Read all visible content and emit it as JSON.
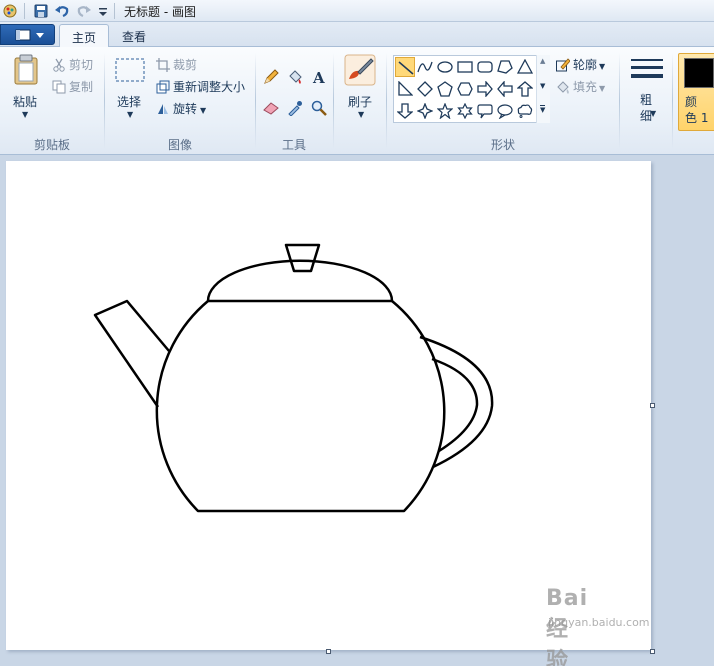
{
  "window": {
    "title": "无标题 - 画图"
  },
  "quick_access": {
    "icons": [
      "paint-app-icon",
      "save-icon",
      "undo-icon",
      "redo-icon",
      "customize-dropdown-icon"
    ]
  },
  "tabs": [
    {
      "label": "主页",
      "active": true
    },
    {
      "label": "查看",
      "active": false
    }
  ],
  "ribbon": {
    "clipboard": {
      "paste": "粘贴",
      "cut": "剪切",
      "copy": "复制",
      "label": "剪贴板"
    },
    "image": {
      "select": "选择",
      "crop": "裁剪",
      "resize": "重新调整大小",
      "rotate": "旋转",
      "label": "图像"
    },
    "tools": {
      "label": "工具",
      "icons": [
        "pencil-icon",
        "fill-bucket-icon",
        "text-icon",
        "eraser-icon",
        "color-picker-icon",
        "magnifier-icon"
      ]
    },
    "brushes": {
      "label": "刷子"
    },
    "shapes": {
      "label": "形状",
      "outline": "轮廓",
      "fill": "填充",
      "items": [
        "line",
        "curve",
        "oval",
        "rectangle",
        "rounded-rectangle",
        "polygon",
        "triangle",
        "right-triangle",
        "diamond",
        "pentagon",
        "hexagon",
        "right-arrow",
        "left-arrow",
        "up-arrow",
        "down-arrow",
        "four-point-star",
        "five-point-star",
        "six-point-star",
        "rounded-callout",
        "oval-callout",
        "cloud-callout"
      ],
      "selected": "line"
    },
    "size": {
      "label": "粗\n细"
    },
    "color1": {
      "label": "颜\n色 1",
      "color": "#000000"
    }
  },
  "canvas": {
    "background": "#ffffff",
    "drawing": "teapot-line-drawing"
  },
  "watermark": {
    "brand": "Bai 经验",
    "url": "jingyan.baidu.com"
  }
}
